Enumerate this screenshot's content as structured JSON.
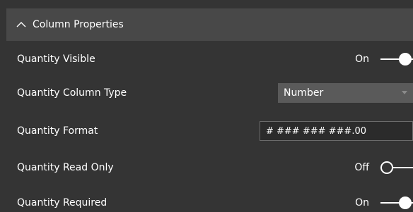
{
  "section": {
    "title": "Column Properties",
    "icon": "chevron-up-icon"
  },
  "rows": [
    {
      "label": "Quantity Visible",
      "type": "toggle",
      "state_text": "On",
      "on": true
    },
    {
      "label": "Quantity Column Type",
      "type": "select",
      "value": "Number"
    },
    {
      "label": "Quantity Format",
      "type": "input",
      "value": "# ### ### ###.00"
    },
    {
      "label": "Quantity Read Only",
      "type": "toggle",
      "state_text": "Off",
      "on": false
    },
    {
      "label": "Quantity Required",
      "type": "toggle",
      "state_text": "On",
      "on": true
    }
  ],
  "colors": {
    "background": "#343434",
    "header": "#484848",
    "select_bg": "#5a5a5a",
    "text": "#ffffff"
  }
}
